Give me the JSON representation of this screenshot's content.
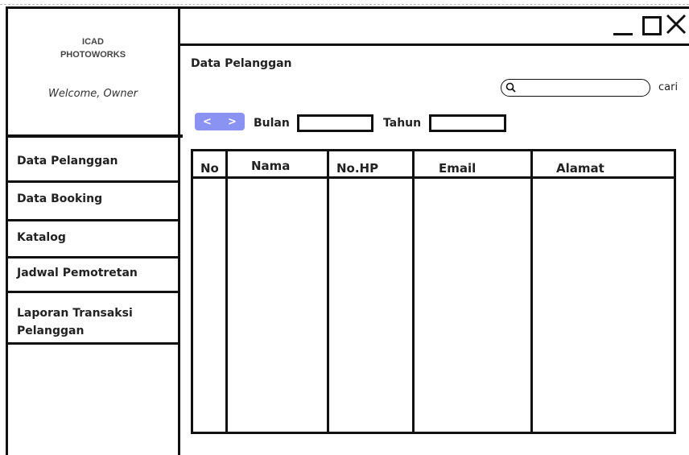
{
  "window": {
    "controls": [
      "minimize-icon",
      "maximize-icon",
      "close-icon"
    ]
  },
  "sidebar": {
    "brand_line1": "ICAD",
    "brand_line2": "PHOTOWORKS",
    "welcome": "Welcome, Owner",
    "items": [
      {
        "label": "Data Pelanggan"
      },
      {
        "label": "Data Booking"
      },
      {
        "label": "Katalog"
      },
      {
        "label": "Jadwal Pemotretan"
      },
      {
        "label": "Laporan Transaksi Pelanggan"
      }
    ]
  },
  "main": {
    "title": "Data Pelanggan",
    "search": {
      "placeholder": "",
      "value": "",
      "button_label": "cari"
    },
    "nav": {
      "prev": "<",
      "next": ">"
    },
    "filters": {
      "month_label": "Bulan",
      "month_value": "",
      "year_label": "Tahun",
      "year_value": ""
    },
    "table": {
      "columns": [
        "No",
        "Nama",
        "No.HP",
        "Email",
        "Alamat"
      ],
      "rows": []
    }
  },
  "colors": {
    "border": "#111111",
    "nav_pill": "#8a93f2"
  }
}
